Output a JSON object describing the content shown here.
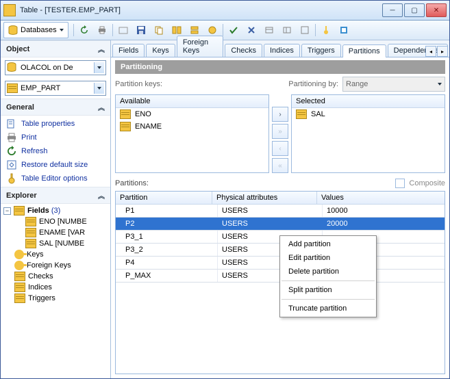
{
  "window": {
    "title": "Table - [TESTER.EMP_PART]"
  },
  "toolbar": {
    "databases_label": "Databases"
  },
  "sidebar": {
    "object_head": "Object",
    "general_head": "General",
    "explorer_head": "Explorer",
    "conn_dropdown": "OLACOL on De",
    "table_dropdown": "EMP_PART",
    "general_items": [
      {
        "label": "Table properties"
      },
      {
        "label": "Print"
      },
      {
        "label": "Refresh"
      },
      {
        "label": "Restore default size"
      },
      {
        "label": "Table Editor options"
      }
    ],
    "tree": {
      "fields_label": "Fields",
      "fields_count": "(3)",
      "fields": [
        "ENO [NUMBE",
        "ENAME [VAR",
        "SAL [NUMBE"
      ],
      "others": [
        "Keys",
        "Foreign Keys",
        "Checks",
        "Indices",
        "Triggers"
      ]
    }
  },
  "tabs": [
    "Fields",
    "Keys",
    "Foreign Keys",
    "Checks",
    "Indices",
    "Triggers",
    "Partitions",
    "Dependencies"
  ],
  "partitioning": {
    "title": "Partitioning",
    "keys_label": "Partition keys:",
    "by_label": "Partitioning by:",
    "by_value": "Range",
    "available_label": "Available",
    "selected_label": "Selected",
    "available": [
      "ENO",
      "ENAME"
    ],
    "selected": [
      "SAL"
    ],
    "partitions_label": "Partitions:",
    "composite_label": "Composite",
    "columns": {
      "c1": "Partition",
      "c2": "Physical attributes",
      "c3": "Values"
    },
    "rows": [
      {
        "p": "P1",
        "a": "USERS",
        "v": "10000",
        "sel": false
      },
      {
        "p": "P2",
        "a": "USERS",
        "v": "20000",
        "sel": true
      },
      {
        "p": "P3_1",
        "a": "USERS",
        "v": "",
        "sel": false
      },
      {
        "p": "P3_2",
        "a": "USERS",
        "v": "",
        "sel": false
      },
      {
        "p": "P4",
        "a": "USERS",
        "v": "",
        "sel": false
      },
      {
        "p": "P_MAX",
        "a": "USERS",
        "v": "",
        "sel": false
      }
    ]
  },
  "context_menu": [
    "Add partition",
    "Edit partition",
    "Delete partition",
    "Split partition",
    "Truncate partition"
  ]
}
